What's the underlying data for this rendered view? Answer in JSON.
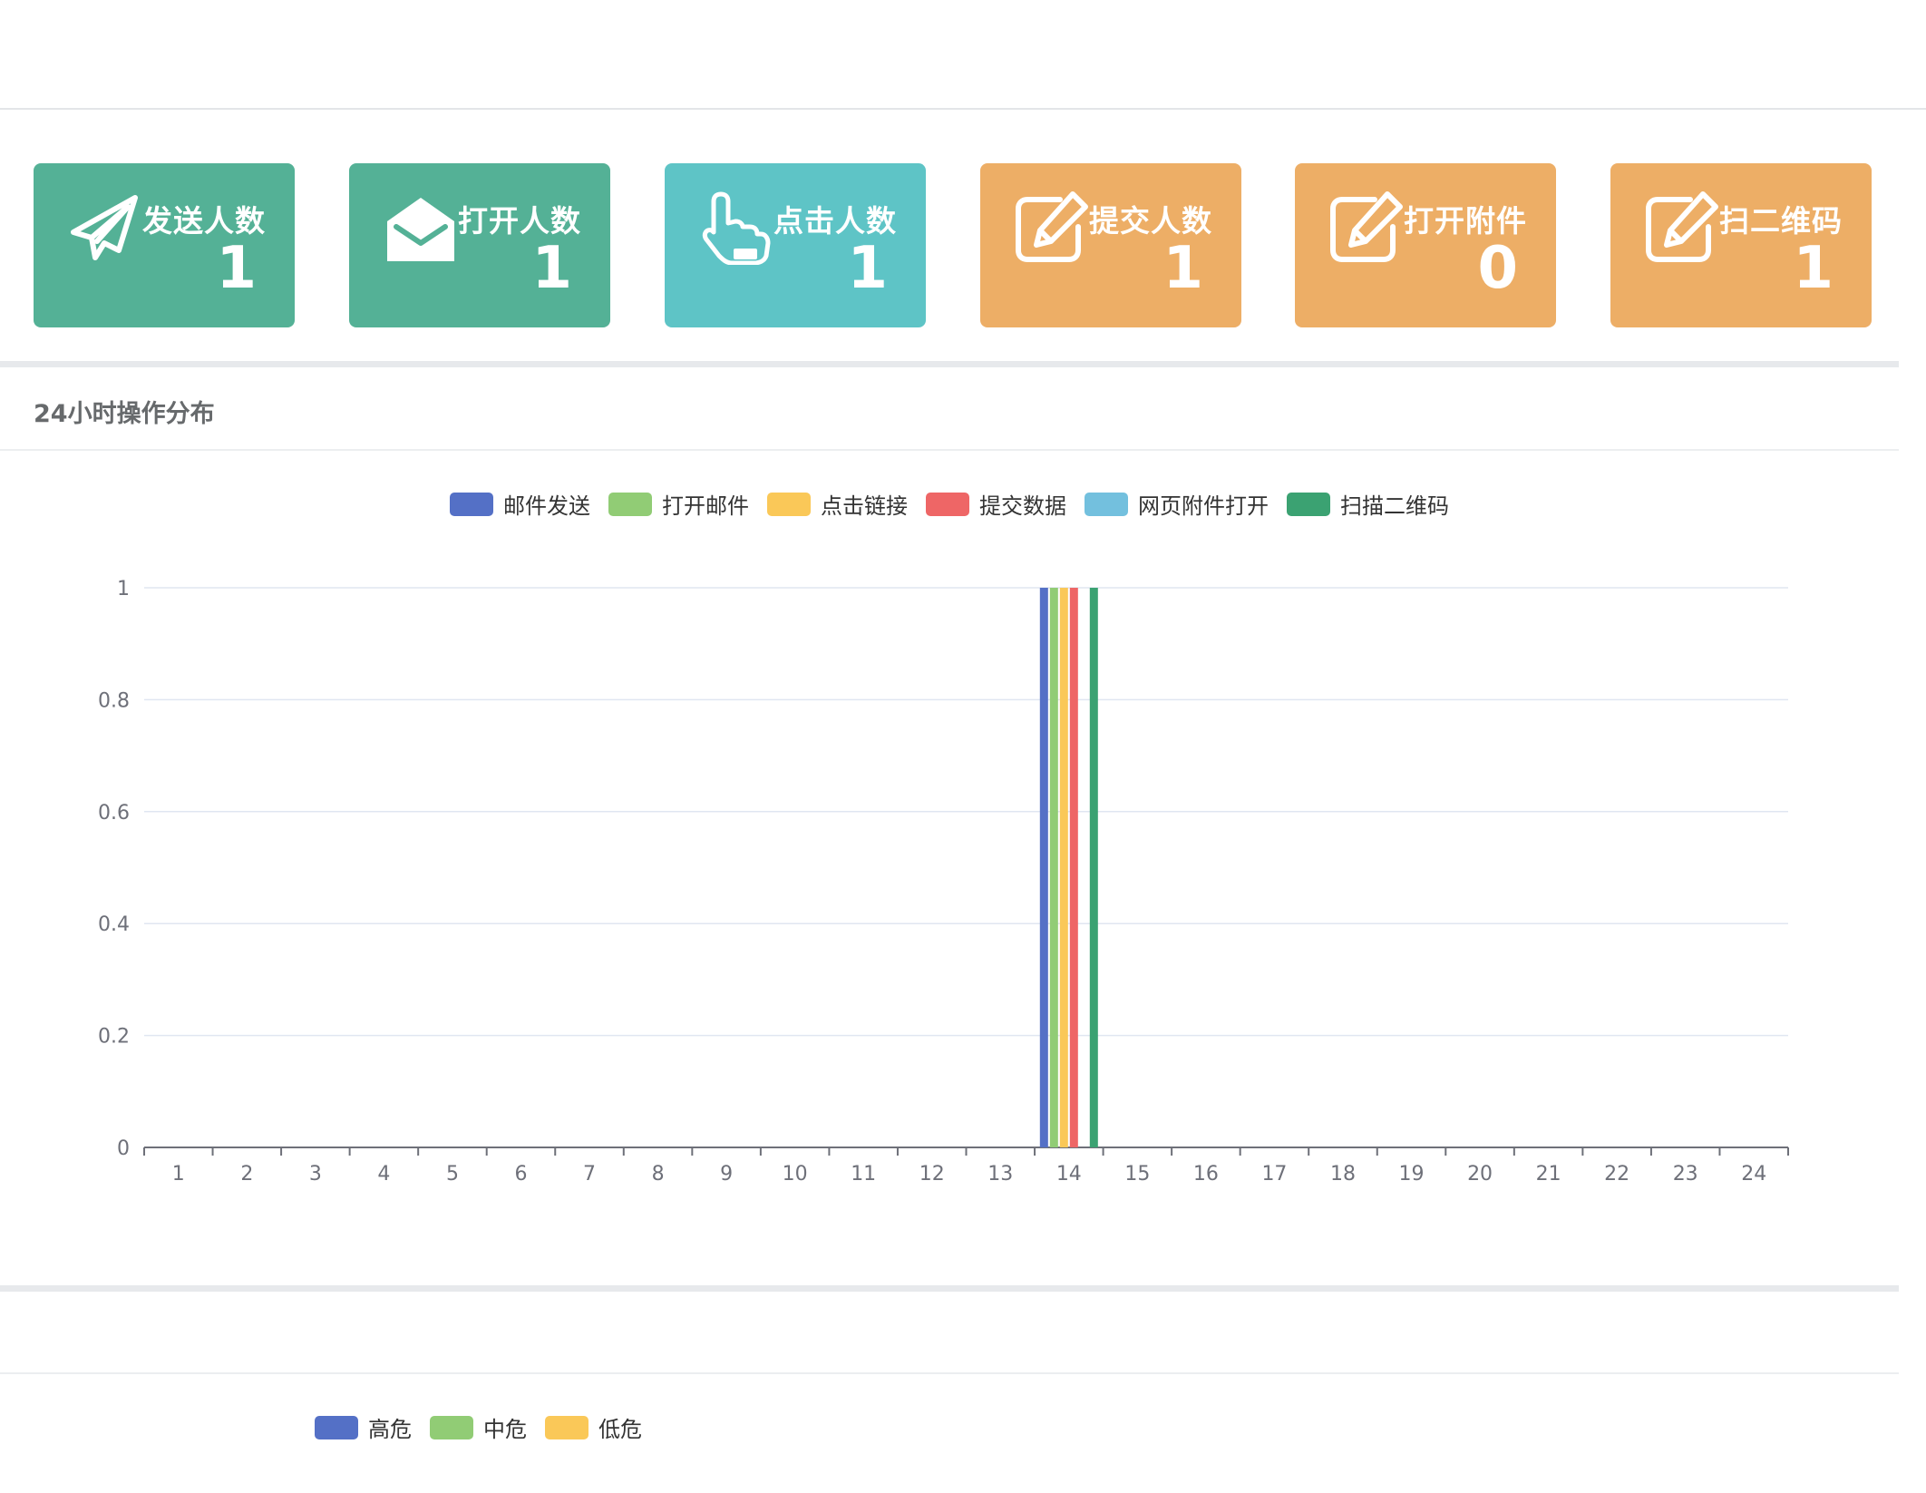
{
  "cards": [
    {
      "label": "发送人数",
      "value": "1",
      "color": "#54b196",
      "icon": "paper-plane-icon"
    },
    {
      "label": "打开人数",
      "value": "1",
      "color": "#54b196",
      "icon": "open-envelope-icon"
    },
    {
      "label": "点击人数",
      "value": "1",
      "color": "#5ec4c6",
      "icon": "pointer-hand-icon"
    },
    {
      "label": "提交人数",
      "value": "1",
      "color": "#edae66",
      "icon": "edit-icon"
    },
    {
      "label": "打开附件",
      "value": "0",
      "color": "#edae66",
      "icon": "edit-icon"
    },
    {
      "label": "扫二维码",
      "value": "1",
      "color": "#edae66",
      "icon": "edit-icon"
    }
  ],
  "section": {
    "title": "24小时操作分布"
  },
  "chart_data": {
    "type": "bar",
    "title": "24小时操作分布",
    "xlabel": "",
    "ylabel": "",
    "categories": [
      "1",
      "2",
      "3",
      "4",
      "5",
      "6",
      "7",
      "8",
      "9",
      "10",
      "11",
      "12",
      "13",
      "14",
      "15",
      "16",
      "17",
      "18",
      "19",
      "20",
      "21",
      "22",
      "23",
      "24"
    ],
    "ylim": [
      0,
      1
    ],
    "yticks": [
      "0",
      "0.2",
      "0.4",
      "0.6",
      "0.8",
      "1"
    ],
    "grid": true,
    "legend_position": "top-center",
    "series": [
      {
        "name": "邮件发送",
        "color": "#5470c6",
        "values": [
          0,
          0,
          0,
          0,
          0,
          0,
          0,
          0,
          0,
          0,
          0,
          0,
          0,
          1,
          0,
          0,
          0,
          0,
          0,
          0,
          0,
          0,
          0,
          0
        ]
      },
      {
        "name": "打开邮件",
        "color": "#91cc75",
        "values": [
          0,
          0,
          0,
          0,
          0,
          0,
          0,
          0,
          0,
          0,
          0,
          0,
          0,
          1,
          0,
          0,
          0,
          0,
          0,
          0,
          0,
          0,
          0,
          0
        ]
      },
      {
        "name": "点击链接",
        "color": "#fac858",
        "values": [
          0,
          0,
          0,
          0,
          0,
          0,
          0,
          0,
          0,
          0,
          0,
          0,
          0,
          1,
          0,
          0,
          0,
          0,
          0,
          0,
          0,
          0,
          0,
          0
        ]
      },
      {
        "name": "提交数据",
        "color": "#ee6666",
        "values": [
          0,
          0,
          0,
          0,
          0,
          0,
          0,
          0,
          0,
          0,
          0,
          0,
          0,
          1,
          0,
          0,
          0,
          0,
          0,
          0,
          0,
          0,
          0,
          0
        ]
      },
      {
        "name": "网页附件打开",
        "color": "#73c0de",
        "values": [
          0,
          0,
          0,
          0,
          0,
          0,
          0,
          0,
          0,
          0,
          0,
          0,
          0,
          0,
          0,
          0,
          0,
          0,
          0,
          0,
          0,
          0,
          0,
          0
        ]
      },
      {
        "name": "扫描二维码",
        "color": "#3ba272",
        "values": [
          0,
          0,
          0,
          0,
          0,
          0,
          0,
          0,
          0,
          0,
          0,
          0,
          0,
          1,
          0,
          0,
          0,
          0,
          0,
          0,
          0,
          0,
          0,
          0
        ]
      }
    ]
  },
  "risk_legend": [
    {
      "name": "高危",
      "color": "#5470c6"
    },
    {
      "name": "中危",
      "color": "#91cc75"
    },
    {
      "name": "低危",
      "color": "#fac858"
    }
  ]
}
